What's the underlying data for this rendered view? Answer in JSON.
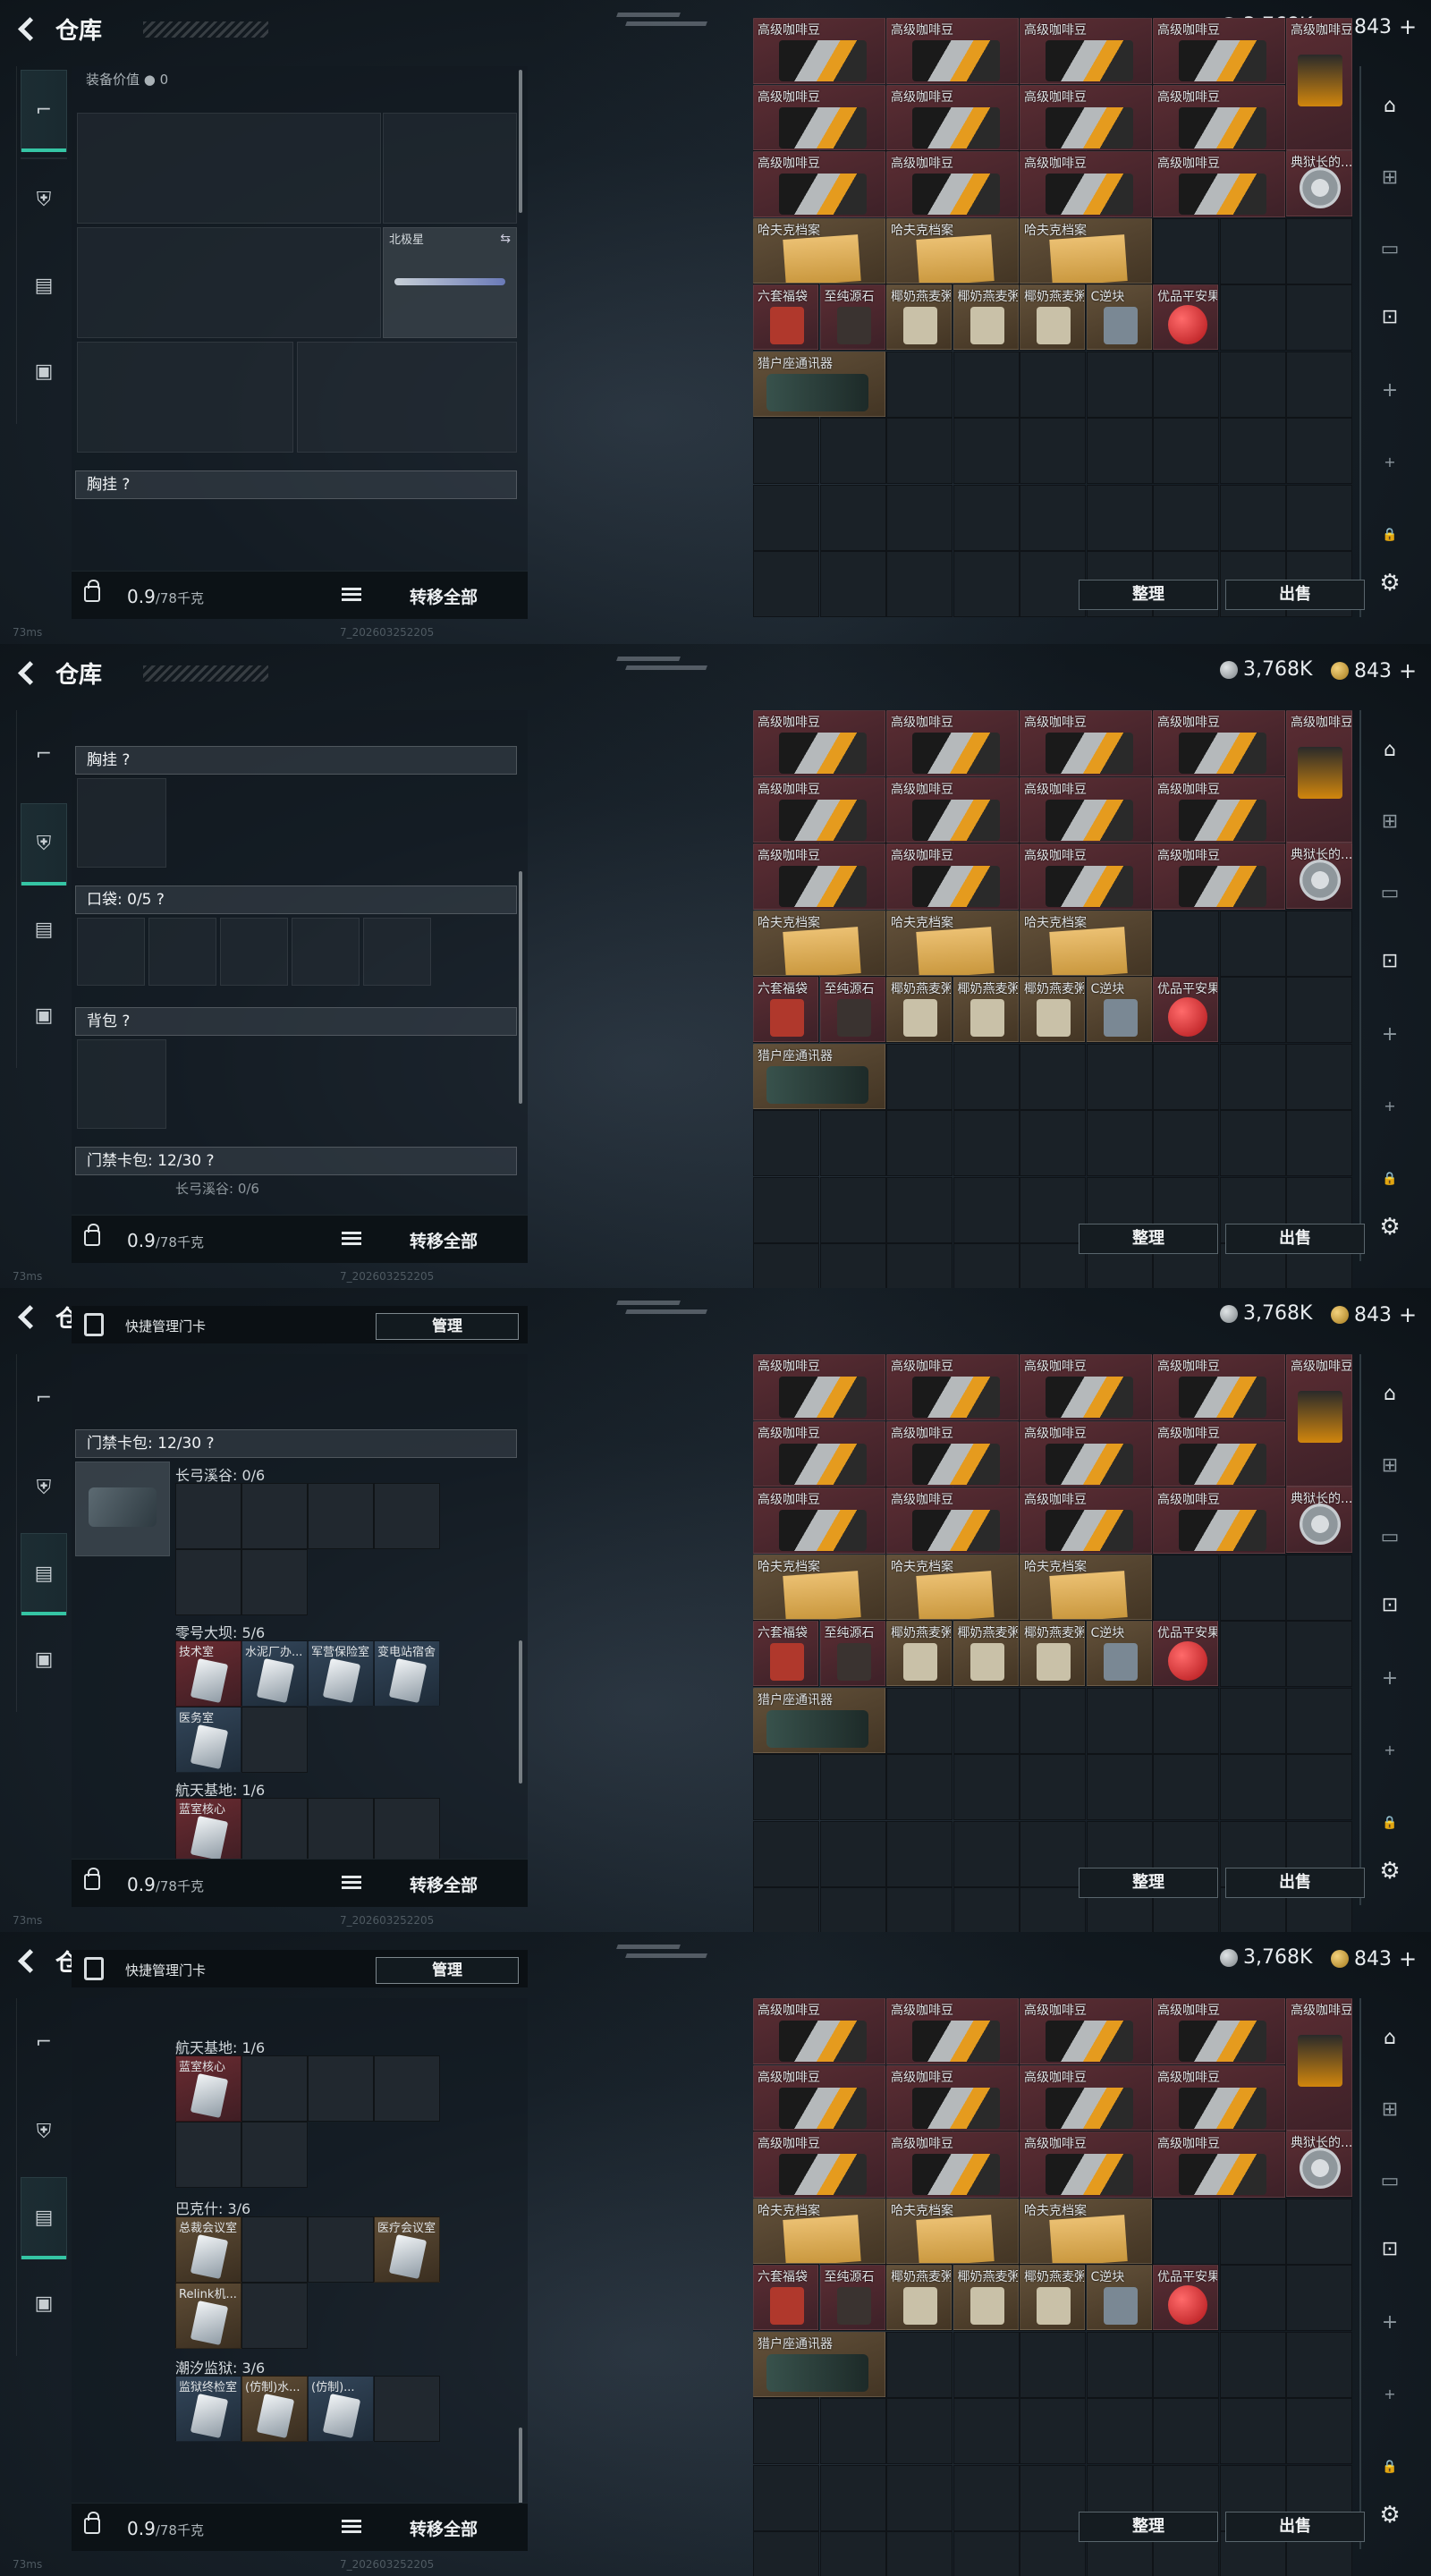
{
  "header": {
    "title": "仓库",
    "silver": "3,768K",
    "gold": "843",
    "plus": "+"
  },
  "footer": {
    "weight": "0.9",
    "capacity": "/78千克",
    "move_all": "转移全部",
    "ping": "73ms",
    "build": "7_202603252205"
  },
  "stash": {
    "sort_button": "整理",
    "sell_button": "出售",
    "coffee": "高级咖啡豆",
    "bag_label": "高级咖啡豆",
    "disc_label": "典狱长的...",
    "paper": "哈夫克档案",
    "misc": [
      "六套福袋",
      "至纯源石",
      "椰奶燕麦粥",
      "椰奶燕麦粥",
      "椰奶燕麦粥",
      "C逆块",
      "优品平安果"
    ],
    "radio": "猎户座通讯器"
  },
  "equip": {
    "value_label": "装备价值",
    "value": "0",
    "knife_name": "北极星",
    "chest_rig": "胸挂 ?",
    "pocket": "口袋: 0/5 ?",
    "backpack": "背包 ?",
    "keycard_case": "门禁卡包: 12/30 ?",
    "changgong": "长弓溪谷: 0/6"
  },
  "keycards": {
    "quick_manage": "快捷管理门卡",
    "manage_btn": "管理",
    "case_title": "门禁卡包: 12/30 ?",
    "changgong": "长弓溪谷: 0/6",
    "dam": "零号大坝: 5/6",
    "dam_cards": [
      "技术室",
      "水泥厂办...",
      "军营保险室",
      "变电站宿舍",
      "医务室"
    ],
    "space": "航天基地: 1/6",
    "space_cards": [
      "蓝室核心"
    ],
    "bakshi": "巴克什: 3/6",
    "bakshi_cards": [
      "总裁会议室",
      "医疗会议室",
      "Relink机..."
    ],
    "tide": "潮汐监狱: 3/6",
    "tide_cards": [
      "监狱终检室",
      "(仿制)水...",
      "(仿制)..."
    ]
  }
}
